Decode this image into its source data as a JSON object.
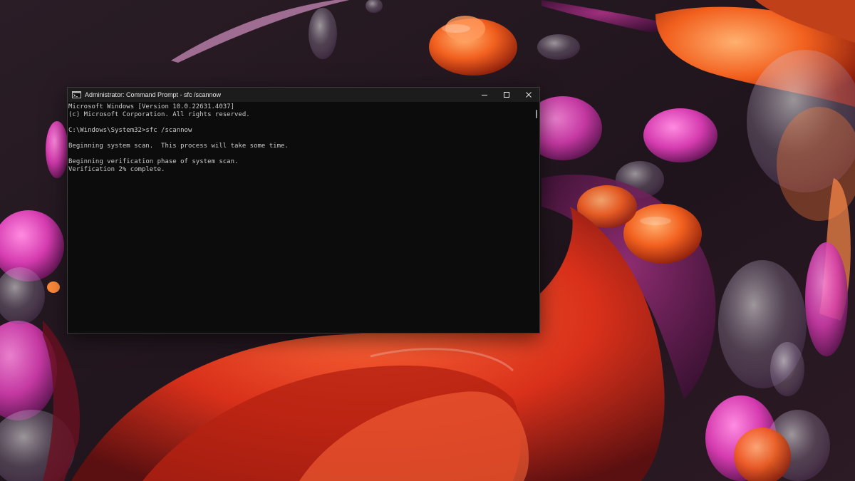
{
  "window": {
    "title": "Administrator: Command Prompt - sfc  /scannow",
    "icon": "cmd-icon",
    "controls": [
      "minimize-icon",
      "maximize-icon",
      "close-icon"
    ]
  },
  "console": {
    "lines": [
      "Microsoft Windows [Version 10.0.22631.4037]",
      "(c) Microsoft Corporation. All rights reserved.",
      "",
      "C:\\Windows\\System32>sfc /scannow",
      "",
      "Beginning system scan.  This process will take some time.",
      "",
      "Beginning verification phase of system scan.",
      "Verification 2% complete."
    ]
  },
  "colors": {
    "console_background": "#0c0c0c",
    "console_text": "#cccccc",
    "title_bar": "#1c1c1c"
  }
}
